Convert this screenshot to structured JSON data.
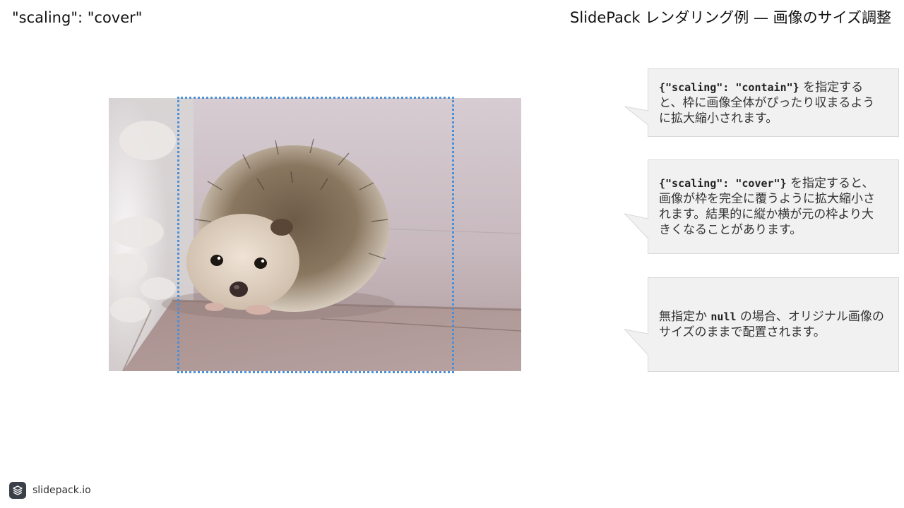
{
  "slide": {
    "label": "\"scaling\": \"cover\"",
    "title": "SlidePack レンダリング例 — 画像のサイズ調整"
  },
  "image": {
    "subject": "hedgehog-photo"
  },
  "callouts": [
    {
      "code": "{\"scaling\": \"contain\"}",
      "text": " を指定すると、枠に画像全体がぴったり収まるように拡大縮小されます。"
    },
    {
      "code": "{\"scaling\": \"cover\"}",
      "text": " を指定すると、画像が枠を完全に覆うように拡大縮小されます。結果的に縦か横が元の枠より大きくなることがあります。"
    },
    {
      "prefix": "無指定か ",
      "code": "null",
      "text": " の場合、オリジナル画像のサイズのままで配置されます。"
    }
  ],
  "footer": {
    "brand": "slidepack.io"
  },
  "colors": {
    "frame_outline": "#4a90d9",
    "callout_fill": "#f1f1f1",
    "callout_border": "#d9d9d9"
  }
}
